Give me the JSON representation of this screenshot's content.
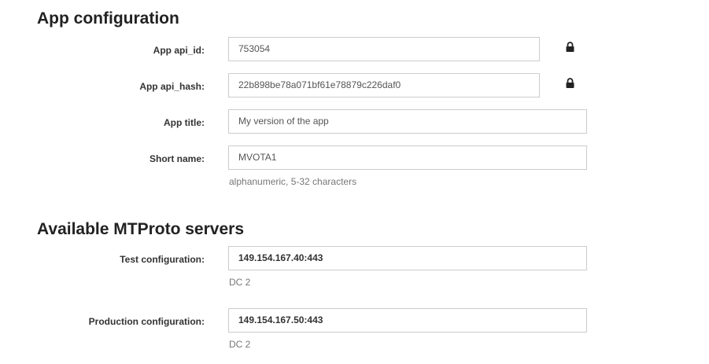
{
  "app_config": {
    "heading": "App configuration",
    "api_id": {
      "label": "App api_id:",
      "value": "753054",
      "icon": "lock-icon"
    },
    "api_hash": {
      "label": "App api_hash:",
      "value": "22b898be78a071bf61e78879c226daf0",
      "icon": "lock-icon"
    },
    "app_title": {
      "label": "App title:",
      "value": "My version of the app"
    },
    "short_name": {
      "label": "Short name:",
      "value": "MVOTA1",
      "help": "alphanumeric, 5-32 characters"
    }
  },
  "servers": {
    "heading": "Available MTProto servers",
    "test": {
      "label": "Test configuration:",
      "value": "149.154.167.40:443",
      "dc": "DC 2"
    },
    "production": {
      "label": "Production configuration:",
      "value": "149.154.167.50:443",
      "dc": "DC 2"
    }
  }
}
